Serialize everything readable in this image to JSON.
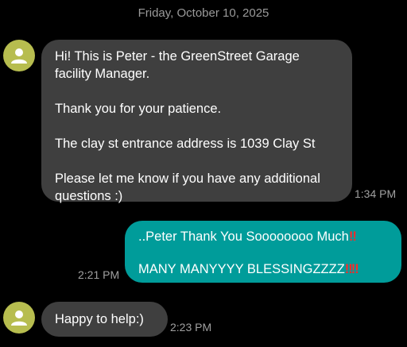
{
  "conversation": {
    "date_header": "Friday, October 10, 2025",
    "messages": [
      {
        "direction": "incoming",
        "avatar_icon": "person-icon",
        "avatar_color": "#b7bd4f",
        "text": "Hi! This is Peter - the GreenStreet Garage facility Manager.\n\nThank you for your patience.\n\nThe clay st entrance address is 1039 Clay St\n\nPlease let me know if you have any additional questions :)",
        "time": "1:34 PM"
      },
      {
        "direction": "outgoing",
        "line1": "..Peter Thank You Soooooooo Much",
        "line1_emoji": "‼",
        "line2": "MANY MANYYYY BLESSINGZZZZ",
        "line2_emoji": "‼‼",
        "time": "2:21 PM"
      },
      {
        "direction": "incoming",
        "avatar_icon": "person-icon",
        "avatar_color": "#b7bd4f",
        "text": "Happy to help:)",
        "time": "2:23 PM"
      }
    ],
    "colors": {
      "background": "#000000",
      "incoming_bubble": "#3f3f3f",
      "outgoing_bubble": "#009c9a",
      "emoji_red": "#ff2a2a"
    }
  }
}
